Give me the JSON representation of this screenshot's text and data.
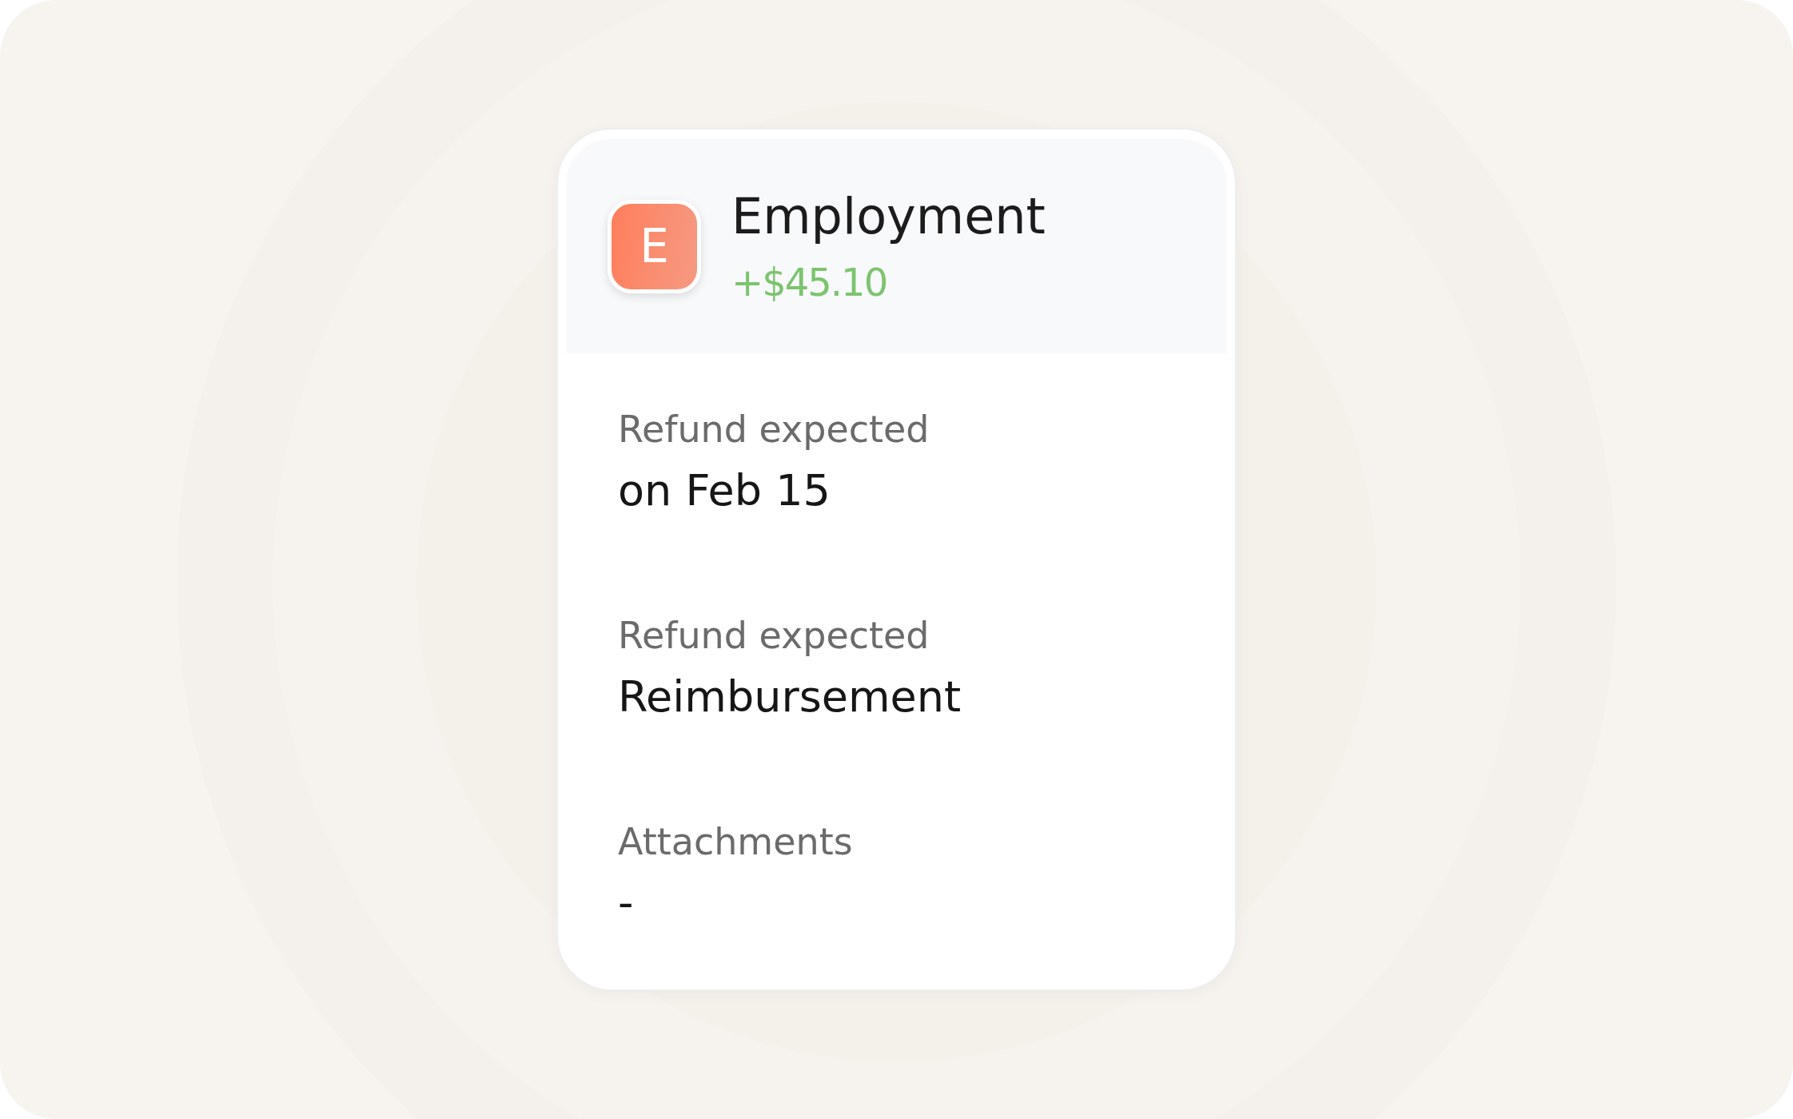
{
  "header": {
    "avatar_letter": "E",
    "title": "Employment",
    "amount": "+$45.10"
  },
  "fields": [
    {
      "label": "Refund expected",
      "value": "on Feb 15"
    },
    {
      "label": "Refund expected",
      "value": "Reimbursement"
    },
    {
      "label": "Attachments",
      "value": "-"
    }
  ]
}
